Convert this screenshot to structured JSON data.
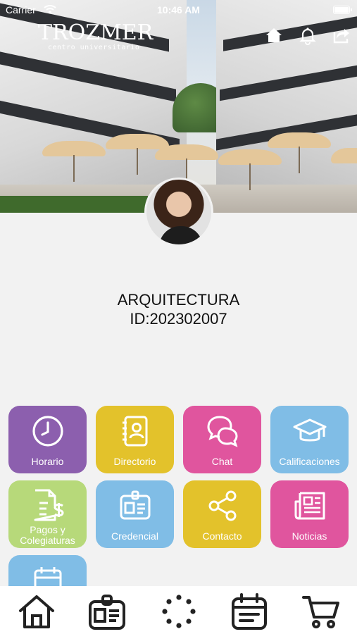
{
  "status_bar": {
    "carrier": "Carrier",
    "time": "10:46 AM"
  },
  "header": {
    "brand": "TROZMER",
    "subtitle": "centro universitario",
    "icons": [
      "home-icon",
      "bell-icon",
      "share-out-icon"
    ]
  },
  "profile": {
    "program": "ARQUITECTURA",
    "id_text": "ID:202302007"
  },
  "menu": {
    "tiles": [
      {
        "label": "Horario",
        "icon": "clock-icon",
        "color": "#8c5fae"
      },
      {
        "label": "Directorio",
        "icon": "contacts-book-icon",
        "color": "#e3c22b"
      },
      {
        "label": "Chat",
        "icon": "chat-bubbles-icon",
        "color": "#e0559e"
      },
      {
        "label": "Calificaciones",
        "icon": "graduation-cap-icon",
        "color": "#80bde6"
      },
      {
        "label": "Pagos y Colegiaturas",
        "icon": "invoice-dollar-icon",
        "color": "#b7d97a"
      },
      {
        "label": "Credencial",
        "icon": "id-badge-icon",
        "color": "#80bde6"
      },
      {
        "label": "Contacto",
        "icon": "share-nodes-icon",
        "color": "#e3c22b"
      },
      {
        "label": "Noticias",
        "icon": "newspaper-icon",
        "color": "#e0559e"
      },
      {
        "label": "",
        "icon": "calendar-icon",
        "color": "#80bde6"
      }
    ]
  },
  "bottom_nav": {
    "items": [
      "home-icon",
      "id-badge-icon",
      "loading-dots-icon",
      "calendar-icon",
      "cart-icon"
    ]
  }
}
